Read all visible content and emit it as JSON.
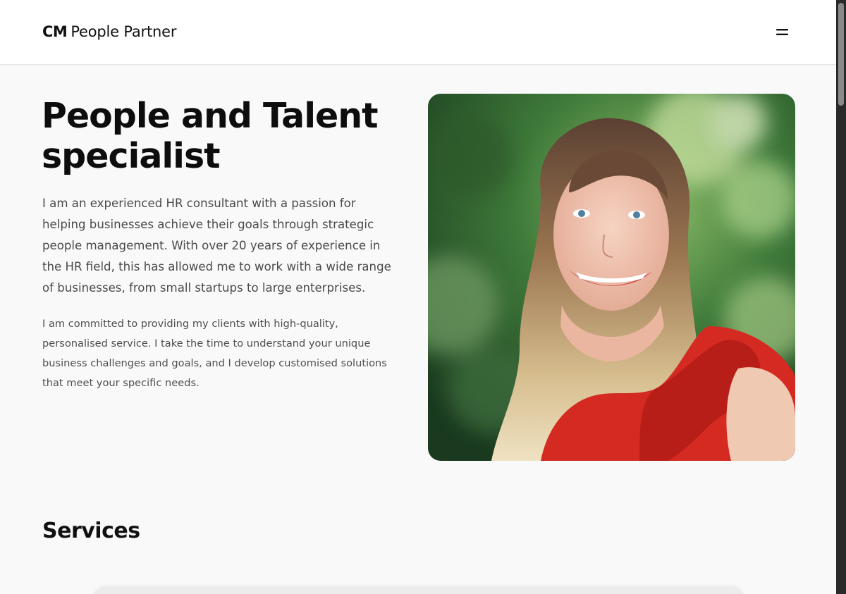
{
  "header": {
    "brand_mark": "CM",
    "brand_name": "People Partner",
    "menu_icon": "hamburger-menu-icon"
  },
  "hero": {
    "title_line1": "People and Talent",
    "title_line2": "specialist",
    "lead": "I am an experienced HR consultant with a passion for helping businesses achieve their goals through strategic people management. With over 20 years of experience in the HR field, this has allowed me to work with a wide range of businesses, from small startups to large enterprises.",
    "sub": "I am committed to providing my clients with high-quality, personalised service. I take the time to understand your unique business challenges and goals, and I develop customised solutions that meet your specific needs."
  },
  "services": {
    "title": "Services"
  },
  "colors": {
    "background": "#f9f9f9",
    "header_bg": "#ffffff",
    "text_primary": "#111111",
    "text_body": "#4a4a4a"
  }
}
